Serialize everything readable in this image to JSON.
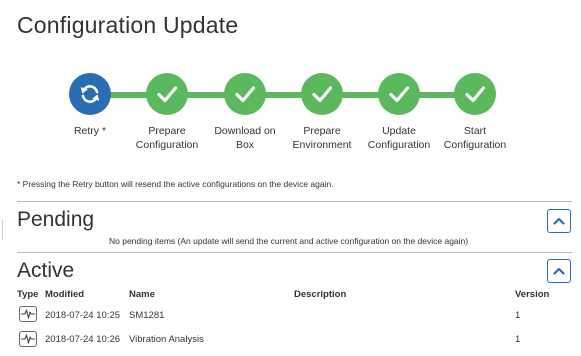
{
  "page": {
    "title": "Configuration Update"
  },
  "steps": [
    {
      "label_line1": "Retry *",
      "label_line2": "",
      "state": "retry",
      "icon": "refresh-icon"
    },
    {
      "label_line1": "Prepare",
      "label_line2": "Configuration",
      "state": "done",
      "icon": "check-icon"
    },
    {
      "label_line1": "Download on",
      "label_line2": "Box",
      "state": "done",
      "icon": "check-icon"
    },
    {
      "label_line1": "Prepare",
      "label_line2": "Environment",
      "state": "done",
      "icon": "check-icon"
    },
    {
      "label_line1": "Update",
      "label_line2": "Configuration",
      "state": "done",
      "icon": "check-icon"
    },
    {
      "label_line1": "Start",
      "label_line2": "Configuration",
      "state": "done",
      "icon": "check-icon"
    }
  ],
  "footnote": "* Pressing the Retry button will resend the active configurations on the device again.",
  "pending": {
    "title": "Pending",
    "message": "No pending items (An update will send the current and active configuration on the device again)"
  },
  "active": {
    "title": "Active",
    "columns": {
      "type": "Type",
      "modified": "Modified",
      "name": "Name",
      "description": "Description",
      "version": "Version"
    },
    "rows": [
      {
        "type_icon": "waveform-icon",
        "modified": "2018-07-24 10:25",
        "name": "SM1281",
        "description": "",
        "version": "1"
      },
      {
        "type_icon": "waveform-icon",
        "modified": "2018-07-24 10:26",
        "name": "Vibration Analysis",
        "description": "",
        "version": "1"
      }
    ]
  },
  "colors": {
    "accent": "#2a6db5",
    "success": "#5cb85c",
    "text": "#333333"
  }
}
